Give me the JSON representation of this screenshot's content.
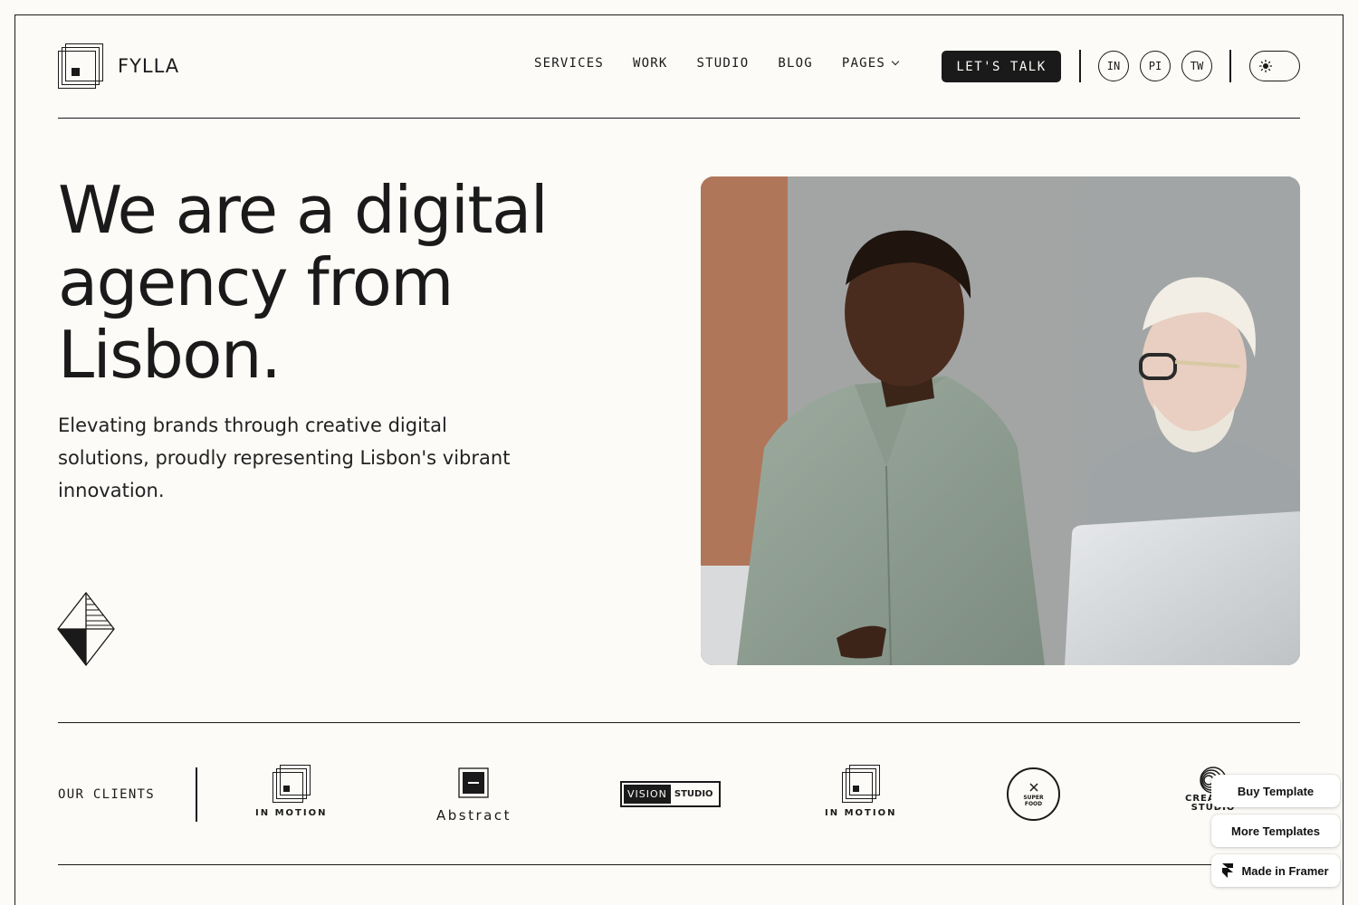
{
  "brand": {
    "name": "FYLLA"
  },
  "nav": {
    "items": [
      {
        "label": "SERVICES"
      },
      {
        "label": "WORK"
      },
      {
        "label": "STUDIO"
      },
      {
        "label": "BLOG"
      },
      {
        "label": "PAGES"
      }
    ],
    "cta_label": "LET'S TALK",
    "social": [
      "IN",
      "PI",
      "TW"
    ]
  },
  "hero": {
    "title": "We are a digital agency from Lisbon.",
    "subtitle": "Elevating brands through creative digital solutions, proudly representing Lisbon's vibrant innovation."
  },
  "clients": {
    "label": "OUR CLIENTS",
    "logos": [
      {
        "name": "IN MOTION"
      },
      {
        "name": "Abstract"
      },
      {
        "name": "VISION",
        "name2": "STUDIO"
      },
      {
        "name": "IN MOTION"
      },
      {
        "name": "SUPER FOOD"
      },
      {
        "name": "CREATIVE",
        "name2": "STUDIO"
      }
    ]
  },
  "framer": {
    "buy": "Buy Template",
    "more": "More Templates",
    "made": "Made in Framer"
  },
  "colors": {
    "ink": "#1a1a1a",
    "background": "#fcfbf7"
  }
}
